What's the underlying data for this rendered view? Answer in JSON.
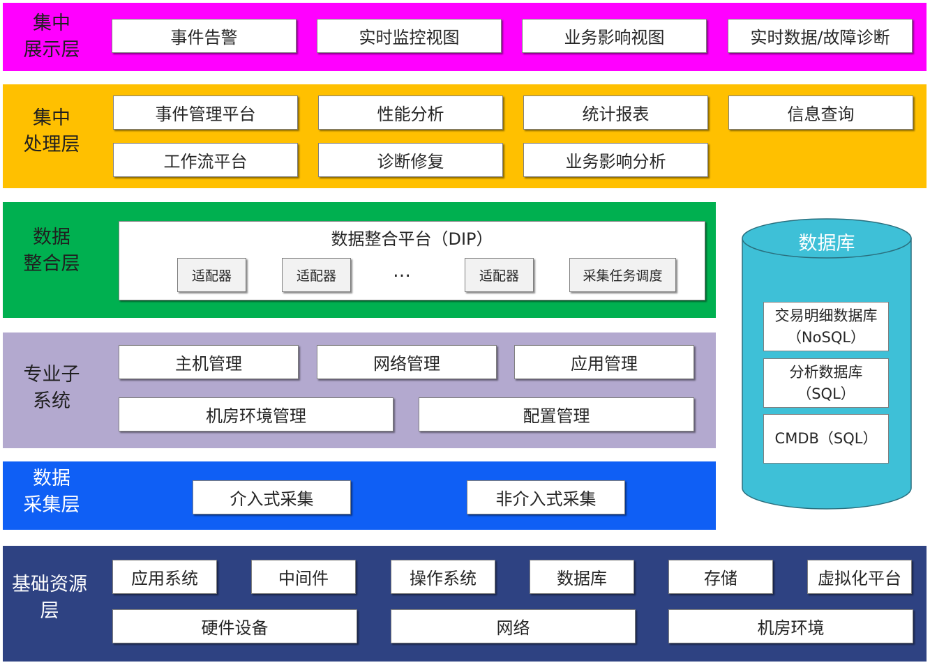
{
  "colors": {
    "presentation": "#ff00ff",
    "processing": "#ffc000",
    "integration": "#00b050",
    "subsystems": "#b3a9cf",
    "collection": "#0f5ff5",
    "infrastructure": "#2e4282",
    "database": "#3ec0d7"
  },
  "layers": {
    "presentation": {
      "label": "集中\n展示层",
      "items": [
        "事件告警",
        "实时监控视图",
        "业务影响视图",
        "实时数据/故障诊断"
      ]
    },
    "processing": {
      "label": "集中\n处理层",
      "items": [
        "事件管理平台",
        "性能分析",
        "统计报表",
        "信息查询",
        "工作流平台",
        "诊断修复",
        "业务影响分析"
      ]
    },
    "integration": {
      "label": "数据\n整合层",
      "platform_title": "数据整合平台（DIP）",
      "adapters": [
        "适配器",
        "适配器",
        "适配器"
      ],
      "ellipsis": "…",
      "scheduler": "采集任务调度"
    },
    "subsystems": {
      "label": "专业子\n系统",
      "items": [
        "主机管理",
        "网络管理",
        "应用管理",
        "机房环境管理",
        "配置管理"
      ]
    },
    "collection": {
      "label": "数据\n采集层",
      "items": [
        "介入式采集",
        "非介入式采集"
      ]
    },
    "infrastructure": {
      "label": "基础资源\n层",
      "items": [
        "应用系统",
        "中间件",
        "操作系统",
        "数据库",
        "存储",
        "虚拟化平台",
        "硬件设备",
        "网络",
        "机房环境"
      ]
    }
  },
  "database": {
    "title": "数据库",
    "items": [
      "交易明细数据库\n（NoSQL）",
      "分析数据库\n（SQL）",
      "CMDB（SQL）"
    ]
  }
}
